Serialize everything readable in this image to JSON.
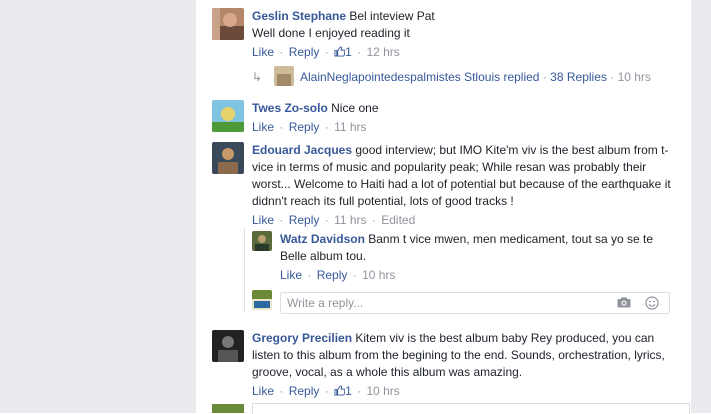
{
  "actions": {
    "like": "Like",
    "reply": "Reply",
    "sep": "·"
  },
  "comments": [
    {
      "name": "Geslin Stephane",
      "text": "Bel inteview Pat",
      "text2": "Well done I enjoyed reading it",
      "likes": "1",
      "time": "12 hrs"
    },
    {
      "name": "Twes Zo-solo",
      "text": "Nice one",
      "time": "11 hrs"
    },
    {
      "name": "Edouard Jacques",
      "text": "good interview; but IMO Kite'm viv is the best album from t-vice in terms of music and popularity peak; While resan was probably their worst... Welcome to Haiti had a lot of potential but because of the earthquake it didnn't reach its full potential, lots of good tracks !",
      "time": "11 hrs",
      "edited": "Edited"
    },
    {
      "name": "Gregory Precilien",
      "text": "Kitem viv is the best album baby Rey produced, you can listen to this album from the begining to the end. Sounds, orchestration, lyrics, groove, vocal, as a whole this album was amazing.",
      "likes": "1",
      "time": "10 hrs"
    }
  ],
  "replies_summary": {
    "who": "AlainNeglapointedespalmistes Stlouis replied",
    "count": "38 Replies",
    "time": "10 hrs"
  },
  "nested_reply": {
    "name": "Watz Davidson",
    "text": "Banm t vice mwen, men medicament, tout sa yo se te Belle album tou.",
    "time": "10 hrs"
  },
  "write_reply": {
    "placeholder": "Write a reply..."
  }
}
